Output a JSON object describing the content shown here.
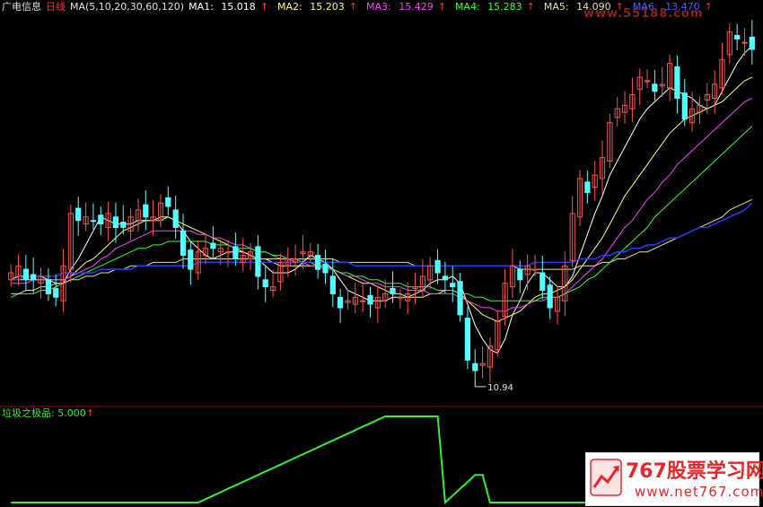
{
  "header": {
    "stock_name": "广电信息",
    "period": "日线",
    "ma_def": "MA(5,10,20,30,60,120)",
    "ma1_label": "MA1:",
    "ma1_value": "15.018",
    "ma2_label": "MA2:",
    "ma2_value": "15.203",
    "ma3_label": "MA3:",
    "ma3_value": "15.429",
    "ma4_label": "MA4:",
    "ma4_value": "15.283",
    "ma5_label": "MA5:",
    "ma5_value": "14.090",
    "ma6_label": "MA6:",
    "ma6_value": "13.470",
    "up_arrow": "↑"
  },
  "price_panel": {
    "low_marker": "10.94"
  },
  "indicator": {
    "label": "垃圾之极品:",
    "value": "5.000",
    "arrow": "↑"
  },
  "watermark": {
    "brand": "767股票学习网",
    "url": "www.net767.com",
    "top_url": "www.55188.com"
  },
  "colors": {
    "background": "#000000",
    "up_candle": "#ff5050",
    "down_candle": "#54ffff",
    "ma1": "#ffffff",
    "ma2": "#ffff66",
    "ma3": "#ff40ff",
    "ma4": "#33ff33",
    "ma5": "#e0e0a8",
    "ma6": "#2040ff",
    "indicator_line": "#33ee33",
    "divider": "#aa0000"
  },
  "chart_data": {
    "type": "candlestick",
    "x": [
      1,
      2,
      3,
      4,
      5,
      6,
      7,
      8,
      9,
      10,
      11,
      12,
      13,
      14,
      15,
      16,
      17,
      18,
      19,
      20,
      21,
      22,
      23,
      24,
      25,
      26,
      27,
      28,
      29,
      30,
      31,
      32,
      33,
      34,
      35,
      36,
      37,
      38,
      39,
      40,
      41,
      42,
      43,
      44,
      45,
      46,
      47,
      48,
      49,
      50,
      51,
      52,
      53,
      54,
      55,
      56,
      57,
      58,
      59,
      60,
      61,
      62,
      63,
      64,
      65,
      66,
      67,
      68,
      69,
      70,
      71,
      72,
      73,
      74,
      75,
      76,
      77,
      78,
      79,
      80,
      81,
      82,
      83,
      84,
      85,
      86,
      87,
      88,
      89,
      90,
      91,
      92,
      93,
      94,
      95,
      96,
      97,
      98,
      99,
      100
    ],
    "close": [
      14.2,
      14.4,
      14.0,
      14.0,
      14.1,
      13.6,
      13.5,
      14.4,
      15.9,
      15.7,
      15.8,
      15.7,
      15.6,
      15.9,
      15.5,
      15.5,
      15.8,
      16.0,
      15.8,
      15.8,
      16.2,
      16.1,
      15.5,
      14.7,
      14.3,
      14.8,
      14.9,
      14.9,
      14.9,
      14.8,
      14.6,
      14.7,
      14.8,
      14.1,
      13.8,
      13.8,
      14.5,
      14.6,
      14.6,
      14.8,
      14.8,
      14.3,
      14.2,
      13.6,
      13.2,
      13.4,
      13.5,
      13.4,
      13.3,
      13.5,
      13.6,
      13.6,
      13.5,
      13.6,
      13.8,
      14.1,
      14.4,
      14.2,
      14.0,
      13.8,
      13.0,
      11.7,
      11.4,
      11.6,
      12.1,
      12.8,
      13.9,
      14.4,
      14.0,
      14.4,
      14.3,
      13.7,
      13.2,
      13.5,
      14.4,
      15.9,
      16.9,
      16.5,
      17.0,
      17.5,
      18.5,
      18.9,
      19.0,
      19.3,
      19.8,
      19.7,
      19.4,
      19.6,
      20.2,
      19.2,
      18.6,
      18.9,
      19.0,
      19.3,
      19.6,
      20.3,
      21.1,
      20.9,
      20.8,
      20.6
    ],
    "series": [
      {
        "name": "MA1",
        "values": [
          14.0,
          14.1,
          14.1,
          14.1,
          14.1,
          14.0,
          13.9,
          13.9,
          14.3,
          14.6,
          15.0,
          15.4,
          15.8,
          15.7,
          15.6,
          15.6,
          15.6,
          15.7,
          15.7,
          15.7,
          15.8,
          15.8,
          15.7,
          15.4,
          15.1,
          14.9,
          14.7,
          14.6,
          14.7,
          14.8,
          14.8,
          14.8,
          14.7,
          14.6,
          14.4,
          14.2,
          14.2,
          14.2,
          14.3,
          14.5,
          14.7,
          14.6,
          14.5,
          14.3,
          14.0,
          13.7,
          13.6,
          13.5,
          13.4,
          13.4,
          13.4,
          13.5,
          13.5,
          13.5,
          13.6,
          13.7,
          13.9,
          14.0,
          14.0,
          14.1,
          13.9,
          13.3,
          12.7,
          12.3,
          12.0,
          11.9,
          12.3,
          13.0,
          13.4,
          13.9,
          14.2,
          14.2,
          14.0,
          13.8,
          13.8,
          14.1,
          14.7,
          15.3,
          15.9,
          16.4,
          17.0,
          17.4,
          17.8,
          18.2,
          18.6,
          18.9,
          19.1,
          19.3,
          19.5,
          19.4,
          19.3,
          19.2,
          19.0,
          18.9,
          19.0,
          19.4,
          19.8,
          20.2,
          20.5,
          20.7
        ]
      },
      {
        "name": "MA2",
        "values": [
          14.0,
          14.0,
          14.0,
          14.0,
          14.0,
          14.0,
          14.0,
          14.0,
          14.1,
          14.3,
          14.5,
          14.6,
          14.8,
          15.0,
          15.2,
          15.4,
          15.5,
          15.6,
          15.7,
          15.7,
          15.7,
          15.8,
          15.7,
          15.6,
          15.5,
          15.4,
          15.3,
          15.2,
          15.1,
          15.0,
          14.9,
          14.8,
          14.7,
          14.6,
          14.6,
          14.5,
          14.4,
          14.4,
          14.4,
          14.4,
          14.4,
          14.4,
          14.4,
          14.3,
          14.2,
          14.1,
          14.0,
          13.9,
          13.9,
          13.8,
          13.7,
          13.6,
          13.6,
          13.5,
          13.5,
          13.5,
          13.6,
          13.6,
          13.7,
          13.7,
          13.6,
          13.4,
          13.2,
          13.0,
          12.9,
          12.8,
          12.9,
          13.0,
          13.1,
          13.3,
          13.5,
          13.6,
          13.6,
          13.7,
          13.8,
          14.0,
          14.3,
          14.6,
          14.9,
          15.2,
          15.6,
          16.0,
          16.4,
          16.7,
          17.0,
          17.3,
          17.6,
          17.9,
          18.2,
          18.4,
          18.6,
          18.7,
          18.8,
          18.9,
          19.0,
          19.1,
          19.3,
          19.5,
          19.7,
          19.8
        ]
      },
      {
        "name": "MA3",
        "values": [
          13.9,
          13.9,
          13.9,
          14.0,
          14.0,
          14.0,
          14.0,
          14.0,
          14.1,
          14.2,
          14.3,
          14.4,
          14.6,
          14.7,
          14.9,
          15.0,
          15.1,
          15.2,
          15.3,
          15.4,
          15.4,
          15.4,
          15.4,
          15.4,
          15.4,
          15.3,
          15.3,
          15.2,
          15.2,
          15.1,
          15.0,
          15.0,
          14.9,
          14.8,
          14.8,
          14.7,
          14.6,
          14.6,
          14.5,
          14.5,
          14.4,
          14.4,
          14.3,
          14.3,
          14.2,
          14.1,
          14.1,
          14.0,
          13.9,
          13.9,
          13.8,
          13.8,
          13.8,
          13.7,
          13.7,
          13.7,
          13.6,
          13.6,
          13.6,
          13.6,
          13.5,
          13.4,
          13.3,
          13.2,
          13.2,
          13.1,
          13.1,
          13.2,
          13.2,
          13.3,
          13.4,
          13.4,
          13.5,
          13.5,
          13.6,
          13.8,
          14.0,
          14.2,
          14.4,
          14.6,
          14.9,
          15.2,
          15.5,
          15.7,
          16.0,
          16.3,
          16.5,
          16.8,
          17.0,
          17.3,
          17.5,
          17.7,
          17.9,
          18.1,
          18.3,
          18.5,
          18.7,
          18.9,
          19.1,
          19.2
        ]
      },
      {
        "name": "MA4",
        "values": [
          13.5,
          13.6,
          13.6,
          13.6,
          13.7,
          13.7,
          13.8,
          13.9,
          14.0,
          14.1,
          14.2,
          14.3,
          14.4,
          14.5,
          14.6,
          14.7,
          14.8,
          14.9,
          14.9,
          15.0,
          15.0,
          15.1,
          15.1,
          15.1,
          15.1,
          15.1,
          15.1,
          15.0,
          15.0,
          15.0,
          14.9,
          14.9,
          14.9,
          14.8,
          14.8,
          14.7,
          14.7,
          14.6,
          14.6,
          14.5,
          14.5,
          14.4,
          14.4,
          14.3,
          14.2,
          14.2,
          14.1,
          14.1,
          14.0,
          14.0,
          13.9,
          13.9,
          13.9,
          13.8,
          13.8,
          13.8,
          13.8,
          13.7,
          13.7,
          13.7,
          13.6,
          13.6,
          13.5,
          13.5,
          13.4,
          13.4,
          13.4,
          13.4,
          13.4,
          13.4,
          13.4,
          13.5,
          13.5,
          13.5,
          13.6,
          13.7,
          13.8,
          14.0,
          14.1,
          14.3,
          14.5,
          14.7,
          14.9,
          15.1,
          15.3,
          15.5,
          15.8,
          16.0,
          16.2,
          16.4,
          16.6,
          16.8,
          17.0,
          17.2,
          17.4,
          17.6,
          17.8,
          18.0,
          18.2,
          18.4
        ]
      },
      {
        "name": "MA5",
        "values": [
          13.6,
          13.6,
          13.7,
          13.7,
          13.8,
          13.8,
          13.9,
          13.9,
          14.0,
          14.0,
          14.1,
          14.1,
          14.2,
          14.2,
          14.3,
          14.3,
          14.4,
          14.4,
          14.4,
          14.5,
          14.5,
          14.5,
          14.5,
          14.6,
          14.6,
          14.6,
          14.6,
          14.6,
          14.6,
          14.6,
          14.6,
          14.6,
          14.6,
          14.6,
          14.6,
          14.6,
          14.6,
          14.6,
          14.6,
          14.6,
          14.6,
          14.6,
          14.6,
          14.6,
          14.5,
          14.5,
          14.5,
          14.5,
          14.5,
          14.5,
          14.5,
          14.5,
          14.5,
          14.5,
          14.4,
          14.4,
          14.4,
          14.4,
          14.4,
          14.4,
          14.4,
          14.4,
          14.4,
          14.4,
          14.4,
          14.4,
          14.4,
          14.4,
          14.3,
          14.3,
          14.3,
          14.3,
          14.3,
          14.3,
          14.3,
          14.3,
          14.4,
          14.4,
          14.4,
          14.5,
          14.5,
          14.6,
          14.6,
          14.7,
          14.8,
          14.8,
          14.9,
          15.0,
          15.1,
          15.2,
          15.3,
          15.4,
          15.5,
          15.6,
          15.7,
          15.8,
          16.0,
          16.1,
          16.2,
          16.3
        ]
      },
      {
        "name": "MA6",
        "values": [
          14.0,
          14.0,
          14.1,
          14.1,
          14.1,
          14.1,
          14.1,
          14.2,
          14.2,
          14.2,
          14.2,
          14.2,
          14.3,
          14.3,
          14.3,
          14.3,
          14.3,
          14.4,
          14.4,
          14.4,
          14.4,
          14.4,
          14.4,
          14.4,
          14.4,
          14.5,
          14.5,
          14.5,
          14.5,
          14.5,
          14.5,
          14.5,
          14.5,
          14.5,
          14.5,
          14.5,
          14.5,
          14.5,
          14.5,
          14.5,
          14.5,
          14.5,
          14.5,
          14.5,
          14.5,
          14.5,
          14.4,
          14.4,
          14.4,
          14.4,
          14.4,
          14.4,
          14.4,
          14.4,
          14.4,
          14.4,
          14.4,
          14.4,
          14.4,
          14.4,
          14.4,
          14.4,
          14.4,
          14.4,
          14.4,
          14.4,
          14.4,
          14.4,
          14.4,
          14.4,
          14.5,
          14.5,
          14.5,
          14.5,
          14.5,
          14.5,
          14.6,
          14.6,
          14.6,
          14.7,
          14.7,
          14.8,
          14.8,
          14.9,
          14.9,
          15.0,
          15.0,
          15.1,
          15.2,
          15.2,
          15.3,
          15.4,
          15.5,
          15.5,
          15.6,
          15.7,
          15.8,
          15.9,
          16.0,
          16.2
        ]
      }
    ],
    "indicator": {
      "name": "垃圾之极品",
      "values": [
        0,
        0,
        0,
        0,
        0,
        0,
        0,
        0,
        0,
        0,
        0,
        0,
        0,
        0,
        0,
        0,
        0,
        0,
        0,
        0,
        0,
        0,
        0,
        0,
        0,
        0,
        0.2,
        0.4,
        0.6,
        0.8,
        1.0,
        1.2,
        1.4,
        1.6,
        1.8,
        2.0,
        2.2,
        2.4,
        2.6,
        2.8,
        3.0,
        3.2,
        3.4,
        3.6,
        3.8,
        4.0,
        4.2,
        4.4,
        4.6,
        4.8,
        5.0,
        5.0,
        5.0,
        5.0,
        5.0,
        5.0,
        5.0,
        5.0,
        0,
        0.4,
        0.8,
        1.2,
        1.6,
        1.6,
        0,
        0,
        0,
        0,
        0,
        0,
        0,
        0,
        0,
        0,
        0,
        0,
        0,
        0,
        0,
        0,
        0,
        0,
        0,
        0,
        0,
        0,
        0,
        0,
        0,
        0,
        0,
        0,
        0,
        0,
        0,
        0,
        0,
        0,
        0,
        0
      ]
    },
    "ylim": [
      10.5,
      21.5
    ],
    "indicator_ylim": [
      0,
      5.0
    ]
  }
}
